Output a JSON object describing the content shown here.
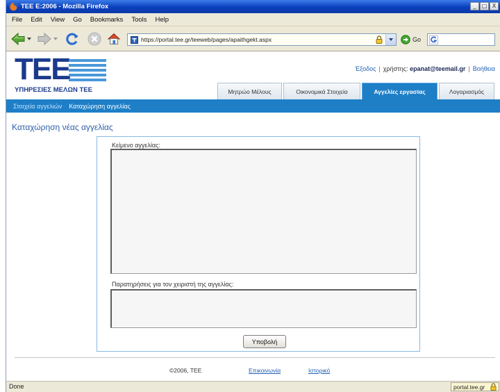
{
  "window": {
    "title": "ΤΕΕ Ε:2006 - Mozilla Firefox",
    "controls": {
      "minimize": "_",
      "maximize": "□",
      "close": "X"
    }
  },
  "menu": {
    "items": [
      "File",
      "Edit",
      "View",
      "Go",
      "Bookmarks",
      "Tools",
      "Help"
    ]
  },
  "toolbar": {
    "url": "https://portal.tee.gr/teeweb/pages/apaithgekt.aspx",
    "go_label": "Go",
    "search_value": "",
    "icons": [
      "back-icon",
      "forward-icon",
      "reload-icon",
      "stop-icon",
      "home-icon",
      "lock-icon",
      "google-icon"
    ]
  },
  "header": {
    "logo_text": "TEE",
    "logo_subtitle": "ΥΠΗΡΕΣΙΕΣ ΜΕΛΩΝ ΤΕΕ",
    "logout_link": "Έξοδος",
    "separator": "|",
    "user_label": "χρήστης:",
    "user_email": "epanat@teemail.gr",
    "help_link": "Βοήθεια"
  },
  "tabs": [
    {
      "label": "Μητρώο Μέλους",
      "active": false
    },
    {
      "label": "Οικονομικά Στοιχεία",
      "active": false
    },
    {
      "label": "Αγγελίες εργασίας",
      "active": true
    },
    {
      "label": "Λογαριασμός",
      "active": false
    }
  ],
  "breadcrumb": {
    "parent": "Στοιχεία αγγελιών",
    "current": "Καταχώρηση αγγελίας"
  },
  "page_title": "Καταχώρηση νέας αγγελίας",
  "form": {
    "ad_text_label": "Κείμενο αγγελίας:",
    "ad_text_value": "",
    "notes_label": "Παρατηρήσεις για τον χειριστή της αγγελίας:",
    "notes_value": "",
    "submit_label": "Υποβολή"
  },
  "footer": {
    "copyright": "©2006, ΤΕΕ",
    "contact_link": "Επικοινωνία",
    "history_link": "Ιστορικό"
  },
  "status": {
    "text": "Done",
    "host": "portal.tee.gr"
  },
  "colors": {
    "accent": "#1e7fc7",
    "logo": "#1b3a8c",
    "stripes": "#4a98d9",
    "heading": "#2e5ea8",
    "link": "#1f5fb5",
    "titlebar": "#0a3fbd",
    "chrome": "#ece9d8",
    "formBorder": "#86b8e2"
  }
}
